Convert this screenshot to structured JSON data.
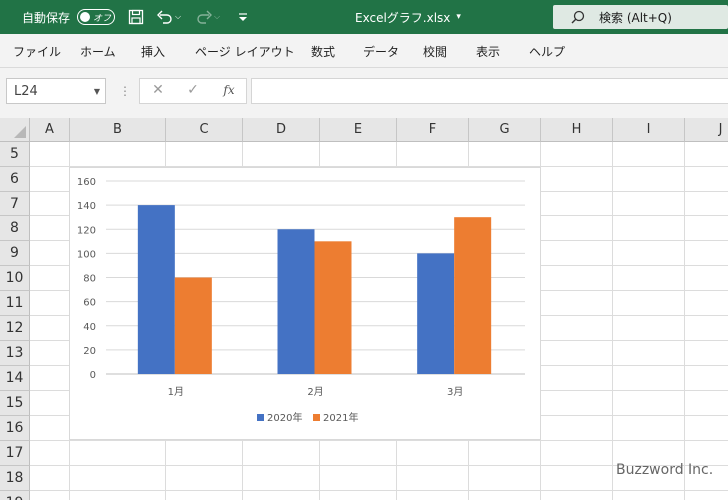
{
  "titlebar": {
    "autosave_label": "自動保存",
    "autosave_state": "オフ",
    "filename": "Excelグラフ.xlsx",
    "search_text": "検索 (Alt+Q)"
  },
  "ribbon": {
    "tabs": [
      "ファイル",
      "ホーム",
      "挿入",
      "ページ レイアウト",
      "数式",
      "データ",
      "校閲",
      "表示",
      "ヘルプ"
    ]
  },
  "formula_bar": {
    "name_box": "L24",
    "fx_label": "fx",
    "formula": ""
  },
  "sheet": {
    "columns": [
      "A",
      "B",
      "C",
      "D",
      "E",
      "F",
      "G",
      "H",
      "I",
      "J"
    ],
    "rows": [
      "5",
      "6",
      "7",
      "8",
      "9",
      "10",
      "11",
      "12",
      "13",
      "14",
      "15",
      "16",
      "17",
      "18",
      "19"
    ]
  },
  "chart_data": {
    "type": "bar",
    "categories": [
      "1月",
      "2月",
      "3月"
    ],
    "series": [
      {
        "name": "2020年",
        "values": [
          140,
          120,
          100
        ],
        "color": "#4472C4"
      },
      {
        "name": "2021年",
        "values": [
          80,
          110,
          130
        ],
        "color": "#ED7D31"
      }
    ],
    "ylim": [
      0,
      160
    ],
    "yticks": [
      "0",
      "20",
      "40",
      "60",
      "80",
      "100",
      "120",
      "140",
      "160"
    ],
    "grid": true,
    "legend": "bottom"
  },
  "watermark": "Buzzword Inc."
}
